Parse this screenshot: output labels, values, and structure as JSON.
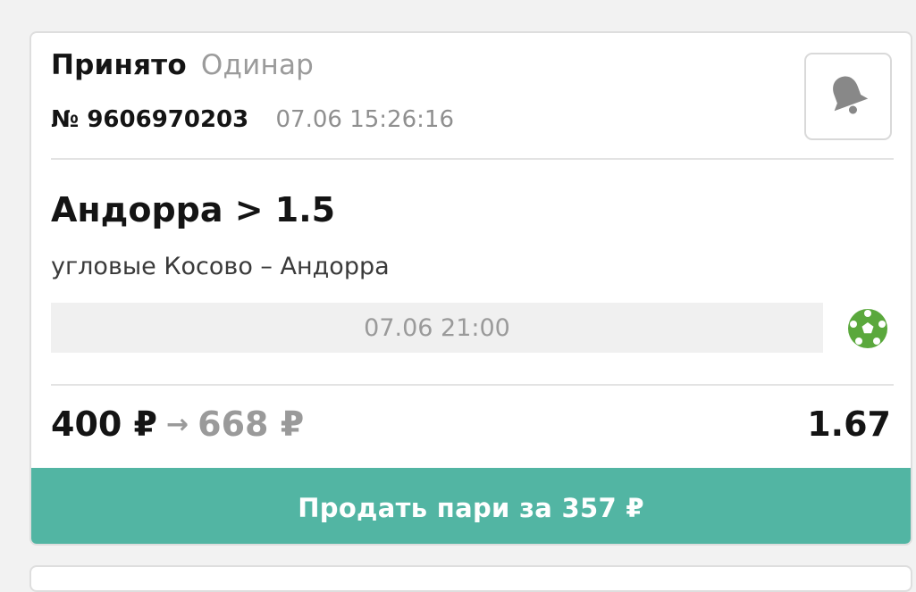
{
  "bet": {
    "status": "Принято",
    "type": "Одинар",
    "number": "№ 9606970203",
    "placed_at": "07.06 15:26:16",
    "market": "Андорра > 1.5",
    "event": "угловые Косово – Андорра",
    "start_time": "07.06 21:00",
    "sport_icon": "soccer-ball-icon",
    "stake": "400 ₽",
    "arrow": "→",
    "payout": "668 ₽",
    "odds": "1.67",
    "sell_label": "Продать пари за 357 ₽"
  },
  "colors": {
    "accent": "#52b5a3",
    "sport_icon": "#5aa83c",
    "muted_text": "#9a9a9a"
  }
}
